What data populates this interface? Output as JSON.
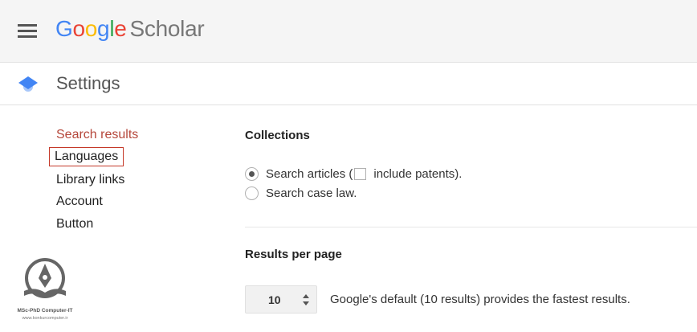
{
  "header": {
    "logo_letters": [
      {
        "char": "G",
        "color": "#4285f4"
      },
      {
        "char": "o",
        "color": "#ea4335"
      },
      {
        "char": "o",
        "color": "#fbbc05"
      },
      {
        "char": "g",
        "color": "#4285f4"
      },
      {
        "char": "l",
        "color": "#34a853"
      },
      {
        "char": "e",
        "color": "#ea4335"
      }
    ],
    "product": "Scholar",
    "menu_icon": "hamburger-menu-icon"
  },
  "settings": {
    "title": "Settings",
    "icon": "scholar-cap-icon"
  },
  "nav": {
    "items": [
      {
        "label": "Search results",
        "active": true
      },
      {
        "label": "Languages",
        "highlighted": true
      },
      {
        "label": "Library links"
      },
      {
        "label": "Account"
      },
      {
        "label": "Button"
      }
    ]
  },
  "collections": {
    "title": "Collections",
    "articles_label_before": "Search articles (",
    "patents_label": "include patents).",
    "case_law_label": "Search case law.",
    "selected": "articles",
    "include_patents": false
  },
  "results_per_page": {
    "title": "Results per page",
    "value": "10",
    "note": "Google's default (10 results) provides the fastest results."
  },
  "watermark": {
    "line1": "MSc-PhD Computer-IT",
    "line2": "www.konkurcomputer.ir"
  },
  "colors": {
    "active_nav": "#b5473b",
    "highlight_box": "#c53929",
    "topbar_bg": "#f5f5f5"
  }
}
